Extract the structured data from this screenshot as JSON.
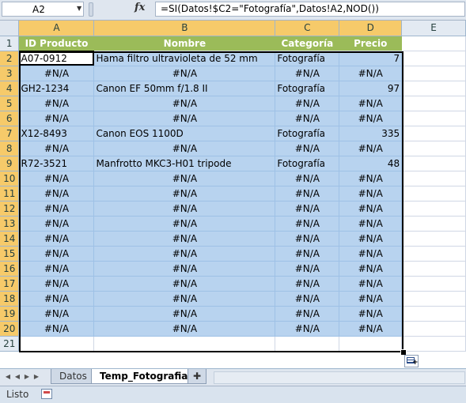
{
  "formula_bar": {
    "name_box": "A2",
    "fx": "fx",
    "formula": "=SI(Datos!$C2=\"Fotografía\",Datos!A2,NOD())"
  },
  "columns": [
    "A",
    "B",
    "C",
    "D",
    "E"
  ],
  "header_row": {
    "row": "1",
    "cells": [
      "ID Producto",
      "Nombre",
      "Categoría",
      "Precio"
    ]
  },
  "rows": [
    {
      "num": "2",
      "a": "A07-0912",
      "b": "Hama filtro ultravioleta de 52 mm",
      "c": "Fotografía",
      "d": "7"
    },
    {
      "num": "3",
      "a": "#N/A",
      "b": "#N/A",
      "c": "#N/A",
      "d": "#N/A"
    },
    {
      "num": "4",
      "a": "GH2-1234",
      "b": "Canon EF 50mm f/1.8 II",
      "c": "Fotografía",
      "d": "97"
    },
    {
      "num": "5",
      "a": "#N/A",
      "b": "#N/A",
      "c": "#N/A",
      "d": "#N/A"
    },
    {
      "num": "6",
      "a": "#N/A",
      "b": "#N/A",
      "c": "#N/A",
      "d": "#N/A"
    },
    {
      "num": "7",
      "a": "X12-8493",
      "b": "Canon EOS 1100D",
      "c": "Fotografía",
      "d": "335"
    },
    {
      "num": "8",
      "a": "#N/A",
      "b": "#N/A",
      "c": "#N/A",
      "d": "#N/A"
    },
    {
      "num": "9",
      "a": "R72-3521",
      "b": "Manfrotto MKC3-H01 tripode",
      "c": "Fotografía",
      "d": "48"
    },
    {
      "num": "10",
      "a": "#N/A",
      "b": "#N/A",
      "c": "#N/A",
      "d": "#N/A"
    },
    {
      "num": "11",
      "a": "#N/A",
      "b": "#N/A",
      "c": "#N/A",
      "d": "#N/A"
    },
    {
      "num": "12",
      "a": "#N/A",
      "b": "#N/A",
      "c": "#N/A",
      "d": "#N/A"
    },
    {
      "num": "13",
      "a": "#N/A",
      "b": "#N/A",
      "c": "#N/A",
      "d": "#N/A"
    },
    {
      "num": "14",
      "a": "#N/A",
      "b": "#N/A",
      "c": "#N/A",
      "d": "#N/A"
    },
    {
      "num": "15",
      "a": "#N/A",
      "b": "#N/A",
      "c": "#N/A",
      "d": "#N/A"
    },
    {
      "num": "16",
      "a": "#N/A",
      "b": "#N/A",
      "c": "#N/A",
      "d": "#N/A"
    },
    {
      "num": "17",
      "a": "#N/A",
      "b": "#N/A",
      "c": "#N/A",
      "d": "#N/A"
    },
    {
      "num": "18",
      "a": "#N/A",
      "b": "#N/A",
      "c": "#N/A",
      "d": "#N/A"
    },
    {
      "num": "19",
      "a": "#N/A",
      "b": "#N/A",
      "c": "#N/A",
      "d": "#N/A"
    },
    {
      "num": "20",
      "a": "#N/A",
      "b": "#N/A",
      "c": "#N/A",
      "d": "#N/A"
    }
  ],
  "last_row": {
    "num": "21"
  },
  "sheet_tabs": [
    {
      "label": "Datos",
      "active": false
    },
    {
      "label": "Temp_Fotografia",
      "active": true
    }
  ],
  "status_bar": {
    "text": "Listo"
  },
  "colors": {
    "header_green": "#9bbb59",
    "selection_blue": "#b8d3ef",
    "active_header": "#f6ca6a"
  },
  "icons": [
    "chevron-down-icon",
    "fx-icon",
    "insert-sheet-icon",
    "quick-analysis-icon",
    "macro-record-icon"
  ]
}
